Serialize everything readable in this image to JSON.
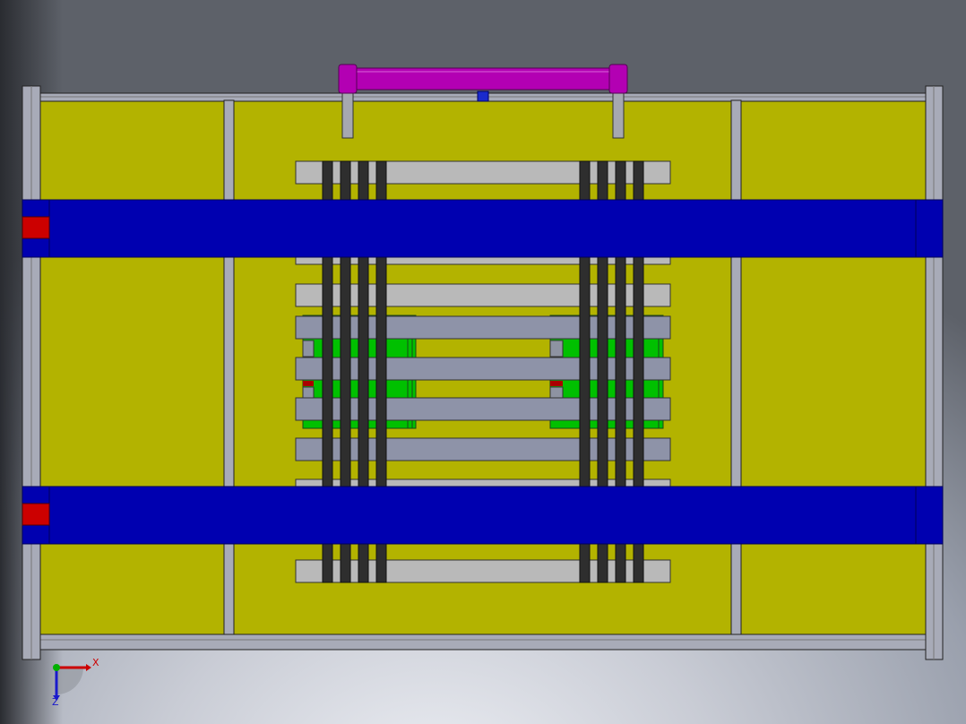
{
  "viewport": {
    "name": "cad-viewport",
    "colors": {
      "yellow_panel": "#b3b300",
      "blue_beam": "#0000b0",
      "red_block": "#cc0000",
      "magenta_cylinder": "#b300b3",
      "green_part": "#00c000",
      "grey_frame": "#a8abb8",
      "light_bar": "#b9b9b9",
      "dark_strip": "#2e2e2e"
    }
  },
  "triad": {
    "x_label": "X",
    "z_label": "Z",
    "x_icon": "x-axis-arrow-icon",
    "z_icon": "z-axis-arrow-icon",
    "y_icon": "y-axis-dot-icon"
  }
}
